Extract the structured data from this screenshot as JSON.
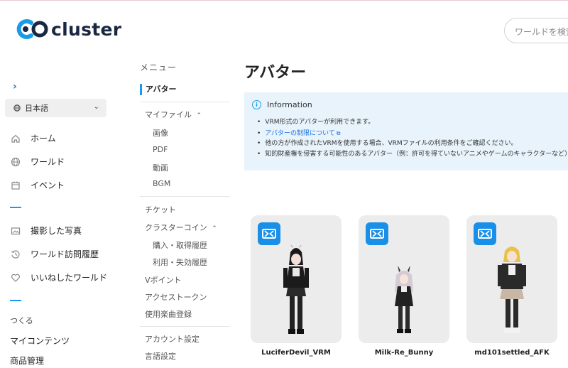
{
  "brand": {
    "name": "cluster",
    "accent": "#1a9be8",
    "dark": "#1a2742"
  },
  "search": {
    "placeholder": "ワールドを検索"
  },
  "sidebar": {
    "language": "日本語",
    "items": [
      {
        "label": "ホーム",
        "icon": "home-icon"
      },
      {
        "label": "ワールド",
        "icon": "globe-icon"
      },
      {
        "label": "イベント",
        "icon": "calendar-icon"
      },
      {
        "label": "撮影した写真",
        "icon": "photo-icon"
      },
      {
        "label": "ワールド訪問履歴",
        "icon": "history-icon"
      },
      {
        "label": "いいねしたワールド",
        "icon": "heart-icon"
      }
    ],
    "create_label": "つくる",
    "my_contents": "マイコンテンツ",
    "product_mgmt": "商品管理"
  },
  "menu": {
    "title": "メニュー",
    "active": "アバター",
    "my_files": "マイファイル",
    "my_files_sub": [
      "画像",
      "PDF",
      "動画",
      "BGM"
    ],
    "ticket": "チケット",
    "coin": "クラスターコイン",
    "coin_sub": [
      "購入・取得履歴",
      "利用・失効履歴"
    ],
    "vpoint": "Vポイント",
    "access_token": "アクセストークン",
    "music": "使用楽曲登録",
    "account": "アカウント設定",
    "language": "言語設定"
  },
  "main": {
    "title": "アバター",
    "info": {
      "heading": "Information",
      "lines": [
        "VRM形式のアバターが利用できます。",
        "アバターの制限について",
        "他の方が作成されたVRMを使用する場合、VRMファイルの利用条件をご確認ください。",
        "知的財産権を侵害する可能性のあるアバター（例：許可を得ていないアニメやゲームのキャラクターなど）"
      ]
    },
    "avatars": [
      {
        "name": "LuciferDevil_VRM"
      },
      {
        "name": "Milk-Re_Bunny"
      },
      {
        "name": "md101settled_AFK"
      }
    ]
  }
}
